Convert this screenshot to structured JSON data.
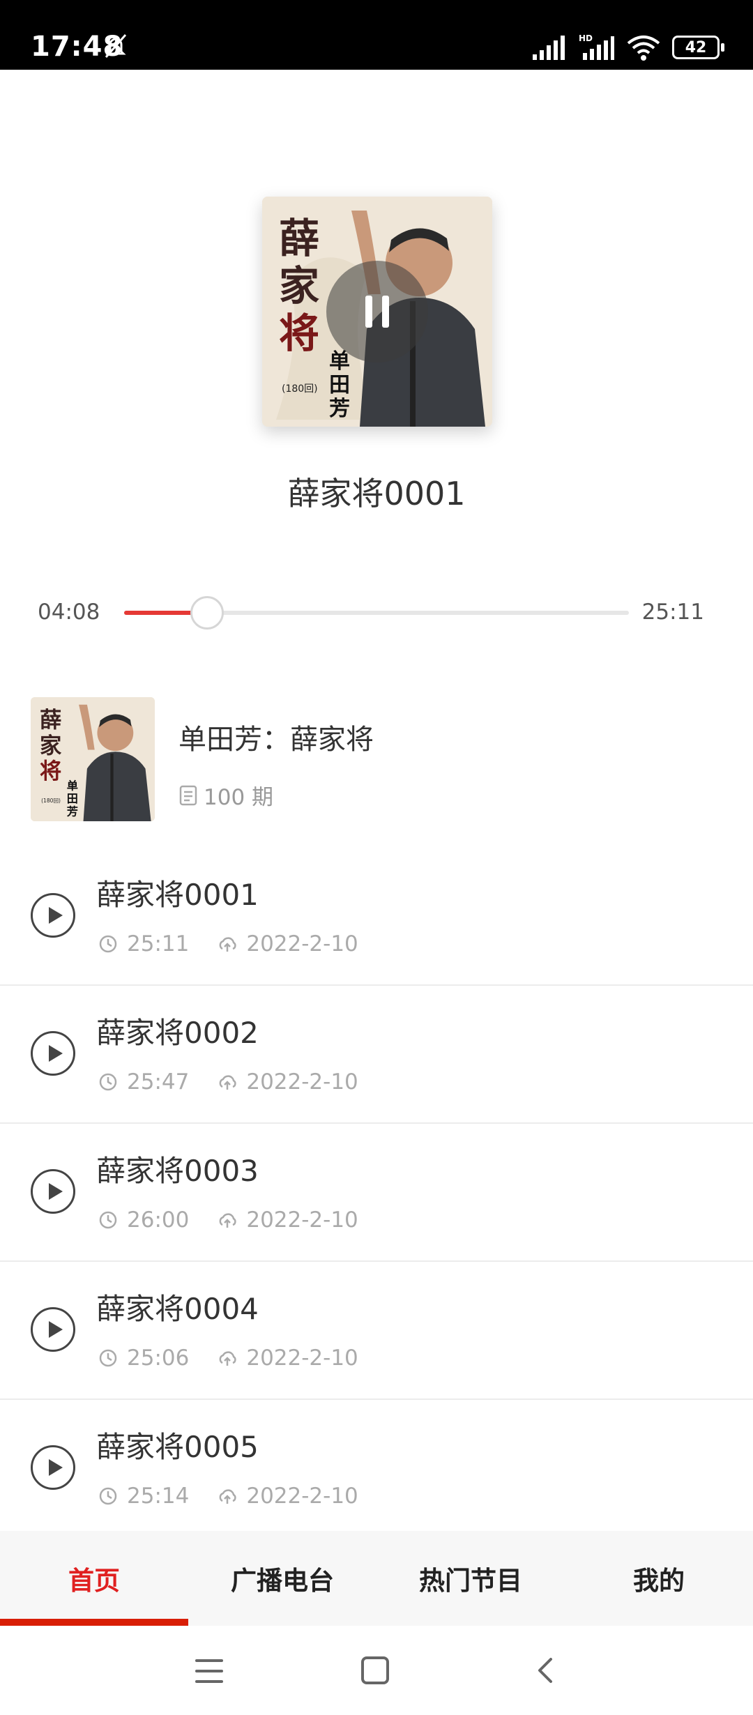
{
  "status_bar": {
    "time": "17:48",
    "battery": "42",
    "icons": [
      "bell-off-icon",
      "signal-icon",
      "signal-hd-icon",
      "wifi-icon",
      "battery-icon"
    ]
  },
  "now_playing": {
    "title": "薛家将0001",
    "current_time": "04:08",
    "total_time": "25:11",
    "progress": 0.165,
    "cover_text": "薛家将",
    "cover_subtext": "单田芳",
    "cover_note": "(180回)"
  },
  "album": {
    "title": "单田芳：薛家将",
    "episodes_count": "100 期"
  },
  "episodes": [
    {
      "title": "薛家将0001",
      "duration": "25:11",
      "date": "2022-2-10"
    },
    {
      "title": "薛家将0002",
      "duration": "25:47",
      "date": "2022-2-10"
    },
    {
      "title": "薛家将0003",
      "duration": "26:00",
      "date": "2022-2-10"
    },
    {
      "title": "薛家将0004",
      "duration": "25:06",
      "date": "2022-2-10"
    },
    {
      "title": "薛家将0005",
      "duration": "25:14",
      "date": "2022-2-10"
    }
  ],
  "tabs": [
    {
      "label": "首页",
      "active": true
    },
    {
      "label": "广播电台",
      "active": false
    },
    {
      "label": "热门节目",
      "active": false
    },
    {
      "label": "我的",
      "active": false
    }
  ],
  "colors": {
    "accent": "#e53935",
    "tab_active": "#e02020",
    "status_bar": "#000000"
  }
}
